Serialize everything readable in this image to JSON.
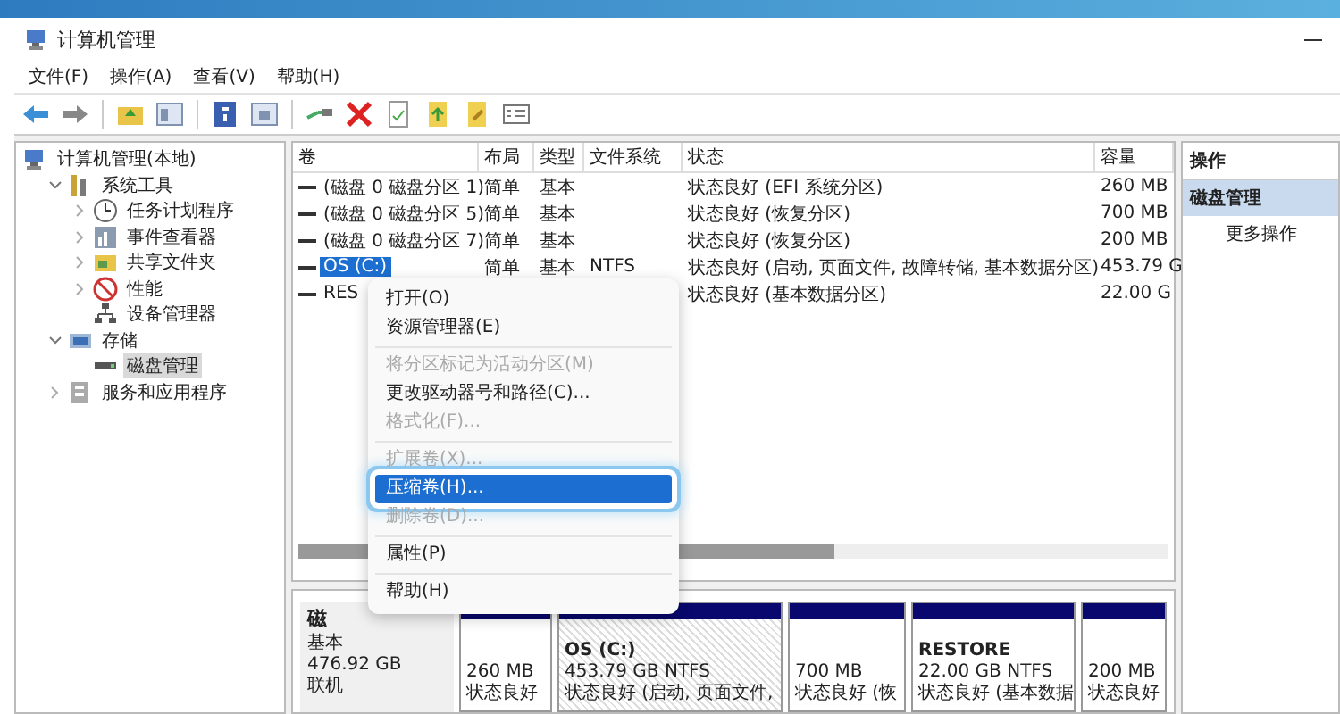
{
  "window": {
    "title": "计算机管理"
  },
  "menu_bar": [
    "文件(F)",
    "操作(A)",
    "查看(V)",
    "帮助(H)"
  ],
  "tree": [
    {
      "label": "计算机管理(本地)",
      "selected": false,
      "children": [
        {
          "label": "系统工具",
          "expanded": true,
          "selected": false,
          "children": [
            {
              "label": "任务计划程序",
              "expanded": false,
              "selected": false
            },
            {
              "label": "事件查看器",
              "expanded": false,
              "selected": false
            },
            {
              "label": "共享文件夹",
              "expanded": false,
              "selected": false
            },
            {
              "label": "性能",
              "expanded": false,
              "selected": false
            },
            {
              "label": "设备管理器",
              "selected": false
            }
          ]
        },
        {
          "label": "存储",
          "expanded": true,
          "selected": false,
          "children": [
            {
              "label": "磁盘管理",
              "selected": true
            }
          ]
        },
        {
          "label": "服务和应用程序",
          "expanded": false,
          "selected": false
        }
      ]
    }
  ],
  "table": {
    "columns": [
      "卷",
      "布局",
      "类型",
      "文件系统",
      "状态",
      "容量"
    ],
    "rows": [
      {
        "selected": false,
        "cells": [
          "(磁盘 0 磁盘分区 1)",
          "简单",
          "基本",
          "",
          "状态良好 (EFI 系统分区)",
          "260 MB"
        ]
      },
      {
        "selected": false,
        "cells": [
          "(磁盘 0 磁盘分区 5)",
          "简单",
          "基本",
          "",
          "状态良好 (恢复分区)",
          "700 MB"
        ]
      },
      {
        "selected": false,
        "cells": [
          "(磁盘 0 磁盘分区 7)",
          "简单",
          "基本",
          "",
          "状态良好 (恢复分区)",
          "200 MB"
        ]
      },
      {
        "selected": true,
        "cells": [
          "OS (C:)",
          "简单",
          "基本",
          "NTFS",
          "状态良好 (启动, 页面文件, 故障转储, 基本数据分区)",
          "453.79 G"
        ]
      },
      {
        "selected": false,
        "cells": [
          "RES",
          "",
          "",
          "",
          "状态良好 (基本数据分区)",
          "22.00 G"
        ]
      }
    ]
  },
  "disk": {
    "label": "磁",
    "lines": [
      "基本",
      "476.92 GB",
      "联机"
    ],
    "partitions": [
      {
        "selected": false,
        "lines": [
          "260 MB",
          "状态良好"
        ]
      },
      {
        "selected": true,
        "name": "OS (C:)",
        "lines": [
          "453.79 GB NTFS",
          "状态良好 (启动, 页面文件,"
        ]
      },
      {
        "selected": false,
        "lines": [
          "700 MB",
          "状态良好 (恢"
        ]
      },
      {
        "selected": false,
        "name": "RESTORE",
        "lines": [
          "22.00 GB NTFS",
          "状态良好 (基本数据"
        ]
      },
      {
        "selected": false,
        "lines": [
          "200 MB",
          "状态良好"
        ]
      }
    ]
  },
  "actions": {
    "title": "操作",
    "items": [
      {
        "label": "磁盘管理",
        "selected": true
      },
      {
        "label": "更多操作",
        "selected": false
      }
    ]
  },
  "context_menu": [
    {
      "kind": "item",
      "label": "打开(O)",
      "disabled": false,
      "selected": false
    },
    {
      "kind": "item",
      "label": "资源管理器(E)",
      "disabled": false,
      "selected": false
    },
    {
      "kind": "separator"
    },
    {
      "kind": "item",
      "label": "将分区标记为活动分区(M)",
      "disabled": true,
      "selected": false
    },
    {
      "kind": "item",
      "label": "更改驱动器号和路径(C)...",
      "disabled": false,
      "selected": false
    },
    {
      "kind": "item",
      "label": "格式化(F)...",
      "disabled": true,
      "selected": false
    },
    {
      "kind": "separator"
    },
    {
      "kind": "item",
      "label": "扩展卷(X)...",
      "disabled": true,
      "selected": false
    },
    {
      "kind": "item",
      "label": "压缩卷(H)...",
      "disabled": false,
      "selected": true
    },
    {
      "kind": "item",
      "label": "删除卷(D)...",
      "disabled": true,
      "selected": false
    },
    {
      "kind": "separator"
    },
    {
      "kind": "item",
      "label": "属性(P)",
      "disabled": false,
      "selected": false
    },
    {
      "kind": "separator"
    },
    {
      "kind": "item",
      "label": "帮助(H)",
      "disabled": false,
      "selected": false
    }
  ]
}
